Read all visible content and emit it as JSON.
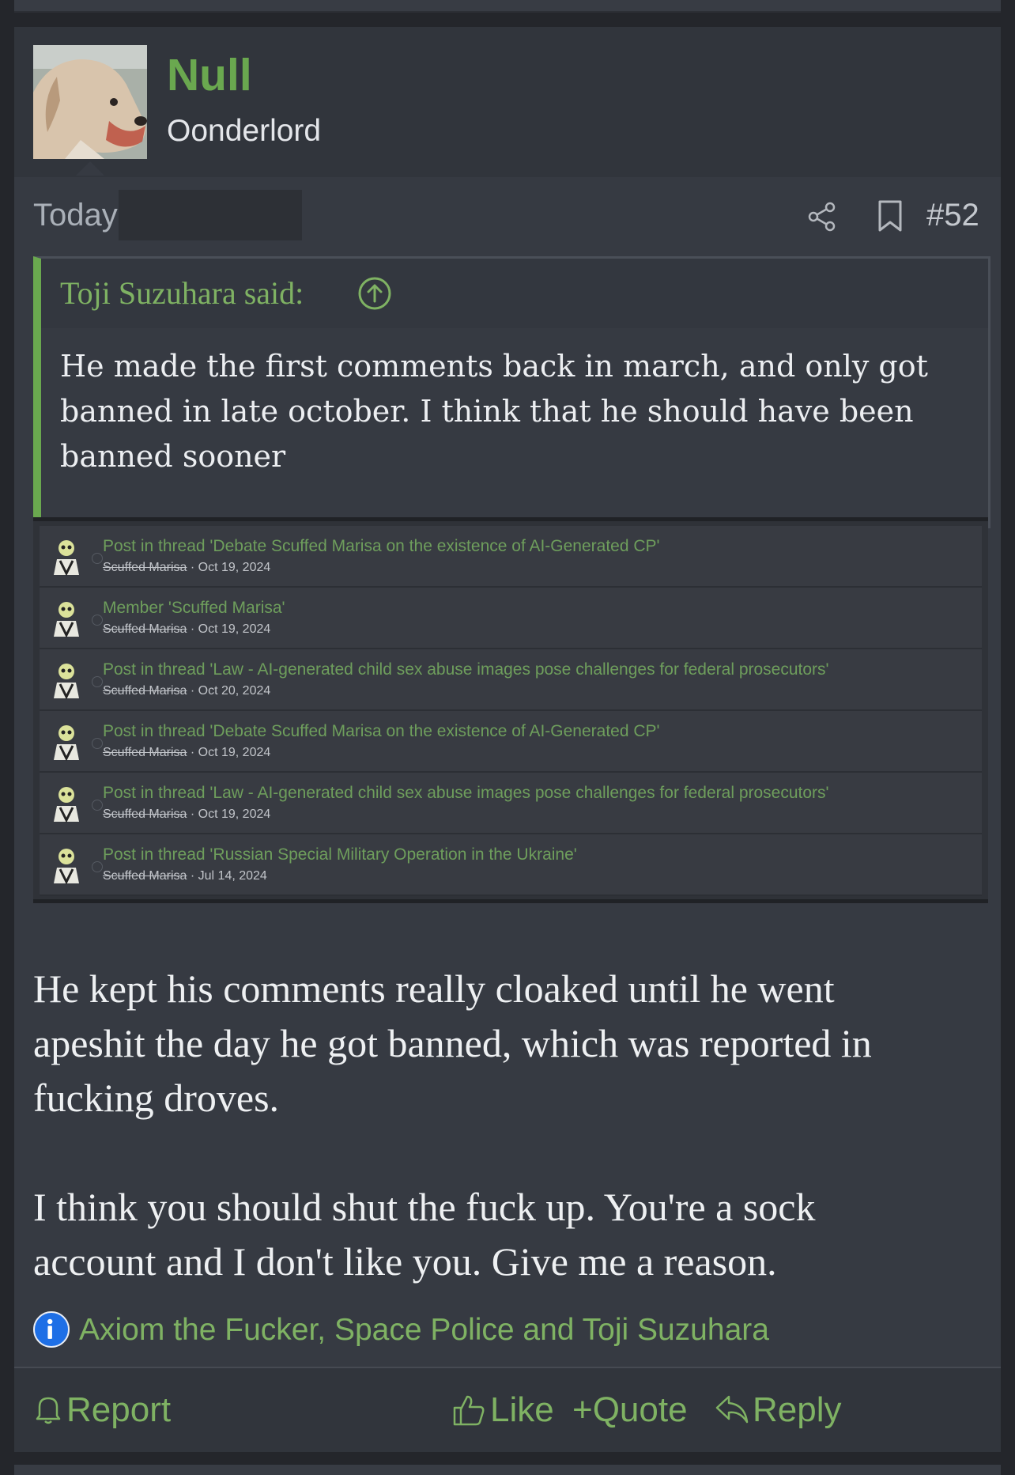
{
  "post": {
    "username": "Null",
    "user_title": "Oonderlord",
    "date": "Today",
    "post_number": "#52",
    "quote": {
      "author": "Toji Suzuhara said:",
      "lines": [
        "He made the first comments back in march, and only got",
        "banned in late october. I think that he should have been",
        "banned sooner"
      ]
    },
    "screenshot_rows": [
      {
        "title": "Post in thread 'Debate Scuffed Marisa on the existence of AI-Generated CP'",
        "user": "Scuffed Marisa",
        "date": "· Oct 19, 2024"
      },
      {
        "title": "Member 'Scuffed Marisa'",
        "user": "Scuffed Marisa",
        "date": "· Oct 19, 2024"
      },
      {
        "title": "Post in thread 'Law - AI-generated child sex abuse images pose challenges for federal prosecutors'",
        "user": "Scuffed Marisa",
        "date": "· Oct 20, 2024"
      },
      {
        "title": "Post in thread 'Debate Scuffed Marisa on the existence of AI-Generated CP'",
        "user": "Scuffed Marisa",
        "date": "· Oct 19, 2024"
      },
      {
        "title": "Post in thread 'Law - AI-generated child sex abuse images pose challenges for federal prosecutors'",
        "user": "Scuffed Marisa",
        "date": "· Oct 19, 2024"
      },
      {
        "title": "Post in thread 'Russian Special Military Operation in the Ukraine'",
        "user": "Scuffed Marisa",
        "date": "· Jul 14, 2024"
      }
    ],
    "body": {
      "p1": [
        "He kept his comments really cloaked until he went",
        "apeshit the day he got banned, which was reported in",
        "fucking droves."
      ],
      "p2": [
        "I think you should shut the fuck up. You're a sock",
        "account and I don't like you. Give me a reason."
      ]
    },
    "reactions_text": "Axiom the Fucker, Space Police and Toji Suzuhara"
  },
  "actions": {
    "report": "Report",
    "like": "Like",
    "quote": "+Quote",
    "reply": "Reply"
  },
  "colors": {
    "accent": "#6aa84f",
    "background": "#24262b",
    "card": "#363a42",
    "info_icon": "#1e6fe6"
  },
  "icons": [
    "share-icon",
    "bookmark-icon",
    "arrow-up-circle-icon",
    "info-icon",
    "bell-icon",
    "thumbs-up-icon",
    "reply-icon"
  ]
}
